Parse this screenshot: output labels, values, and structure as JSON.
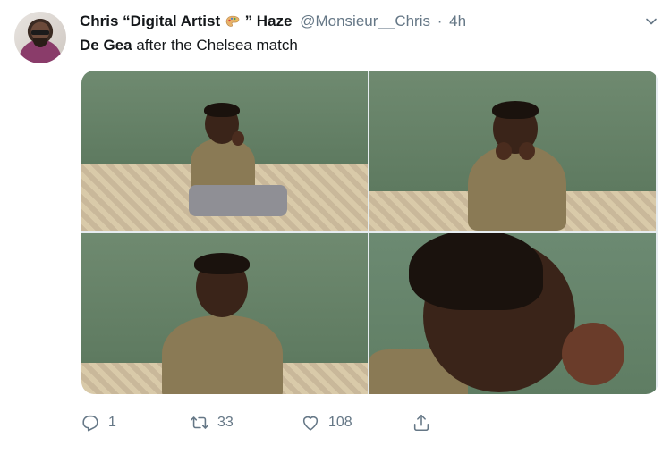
{
  "tweet": {
    "author_name_prefix": "Chris “Digital Artist",
    "author_name_suffix": "” Haze",
    "palette_emoji_icon": "palette-icon",
    "handle": "@Monsieur__Chris",
    "separator": "·",
    "time": "4h",
    "text_bold": "De Gea",
    "text_rest": " after the Chelsea match",
    "menu_icon": "chevron-down-icon"
  },
  "media": {
    "photos": [
      {
        "description_icon": "photo-boy-sitting-wide"
      },
      {
        "description_icon": "photo-boy-hands-on-chin"
      },
      {
        "description_icon": "photo-boy-frowning"
      },
      {
        "description_icon": "photo-boy-closeup"
      }
    ]
  },
  "actions": {
    "reply_count": "1",
    "retweet_count": "33",
    "like_count": "108"
  },
  "colors": {
    "text": "#14171a",
    "secondary": "#657786",
    "wall_green": "#6f8a70"
  }
}
